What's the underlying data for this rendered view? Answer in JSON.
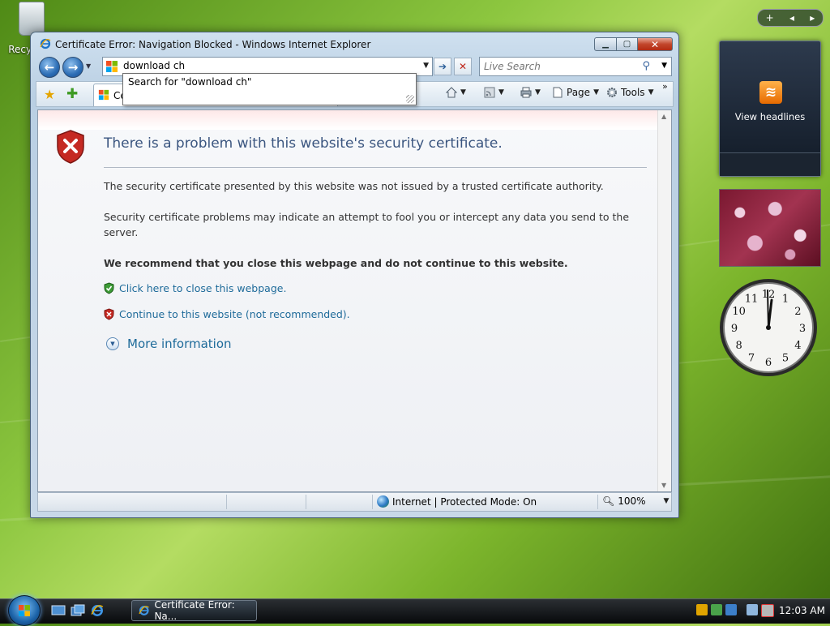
{
  "desktop": {
    "recycle_bin_label": "Recyc",
    "sidebar_control": {
      "add": "+",
      "prev": "◂",
      "next": "▸"
    }
  },
  "window": {
    "title": "Certificate Error: Navigation Blocked - Windows Internet Explorer",
    "buttons": {
      "minimize": "▁",
      "maximize": "▢",
      "close": "✕"
    }
  },
  "navbar": {
    "back": "←",
    "forward": "→",
    "address_value": "download ch",
    "autocomplete_suggestion": "Search for \"download ch\"",
    "search_placeholder": "Live Search",
    "go": "➔",
    "stop": "✕"
  },
  "commandbar": {
    "tab_label": "Ce",
    "page_label": "Page",
    "tools_label": "Tools",
    "overflow": "»"
  },
  "content": {
    "heading": "There is a problem with this website's security certificate.",
    "para1": "The security certificate presented by this website was not issued by a trusted certificate authority.",
    "para2": "Security certificate problems may indicate an attempt to fool you or intercept any data you send to the server.",
    "recommend": "We recommend that you close this webpage and do not continue to this website.",
    "option_close": "Click here to close this webpage.",
    "option_continue": "Continue to this website (not recommended).",
    "more_info": "More information"
  },
  "statusbar": {
    "zone": "Internet | Protected Mode: On",
    "zoom": "100%"
  },
  "gadgets": {
    "feed_label": "View headlines",
    "clock_numbers": [
      "12",
      "1",
      "2",
      "3",
      "4",
      "5",
      "6",
      "7",
      "8",
      "9",
      "10",
      "11"
    ]
  },
  "taskbar": {
    "task_label": "Certificate Error: Na...",
    "time": "12:03 AM"
  },
  "colors": {
    "link": "#1f6b9a",
    "heading": "#3b5680",
    "error_red": "#c0281c"
  }
}
